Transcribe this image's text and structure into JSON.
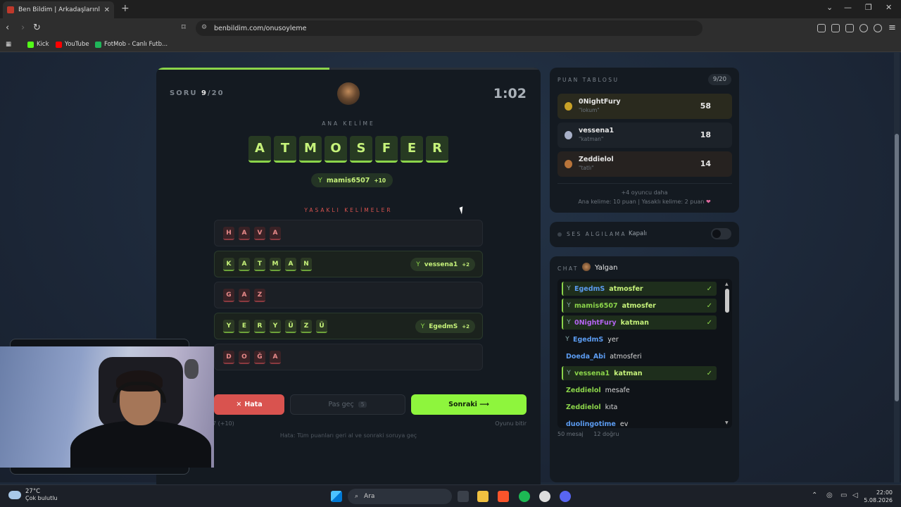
{
  "browser": {
    "tab_title": "Ben Bildim | Arkadaşlarınla Onlin",
    "url": "benbildim.com/onusoyleme",
    "bookmarks": [
      "Kick",
      "YouTube",
      "FotMob - Canlı Futb..."
    ]
  },
  "game": {
    "soru_label": "SORU",
    "soru_current": "9",
    "soru_total": "/20",
    "progress_fraction": 0.45,
    "timer": "1:02",
    "main_word_label": "ANA KELİME",
    "main_word_letters": [
      "A",
      "T",
      "M",
      "O",
      "S",
      "F",
      "E",
      "R"
    ],
    "main_guess": {
      "user": "mamis6507",
      "points": "+10"
    },
    "forbidden_label": "YASAKLI KELİMELER",
    "forbidden": [
      {
        "letters": [
          "H",
          "A",
          "V",
          "A"
        ],
        "hit": false,
        "user": "",
        "points": ""
      },
      {
        "letters": [
          "K",
          "A",
          "T",
          "M",
          "A",
          "N"
        ],
        "hit": true,
        "user": "vessena1",
        "points": "+2"
      },
      {
        "letters": [
          "G",
          "A",
          "Z"
        ],
        "hit": false,
        "user": "",
        "points": ""
      },
      {
        "letters": [
          "Y",
          "E",
          "R",
          "Y",
          "Ü",
          "Z",
          "Ü"
        ],
        "hit": true,
        "user": "EgedmS",
        "points": "+2"
      },
      {
        "letters": [
          "D",
          "O",
          "Ğ",
          "A"
        ],
        "hit": false,
        "user": "",
        "points": ""
      }
    ],
    "btn_hata": "Hata",
    "btn_pas": "Pas geç",
    "btn_pas_count": "5",
    "btn_sonraki": "Sonraki ⟶",
    "sub_left": "7 (+10)",
    "sub_right": "Oyunu bitir",
    "hint": "Hata: Tüm puanları geri al ve sonraki soruya geç"
  },
  "scoreboard": {
    "title": "PUAN TABLOSU",
    "badge": "9/20",
    "rows": [
      {
        "name": "0NightFury",
        "word": "\"lokum\"",
        "score": "58"
      },
      {
        "name": "vessena1",
        "word": "\"katman\"",
        "score": "18"
      },
      {
        "name": "Zeddielol",
        "word": "\"tatlı\"",
        "score": "14"
      }
    ],
    "more": "+4 oyuncu daha",
    "rules": "Ana kelime: 10 puan | Yasaklı kelime: 2 puan"
  },
  "voice": {
    "label": "SES ALGILAMA",
    "state": "Kapalı"
  },
  "chat": {
    "label": "CHAT",
    "user": "Yalgan",
    "messages": [
      {
        "user": "EgedmS",
        "text": "atmosfer",
        "ok": true,
        "color": "#5b9bf0"
      },
      {
        "user": "mamis6507",
        "text": "atmosfer",
        "ok": true,
        "color": "#8bd44a"
      },
      {
        "user": "0NightFury",
        "text": "katman",
        "ok": true,
        "color": "#b464f0"
      },
      {
        "user": "EgedmS",
        "text": "yer",
        "ok": false,
        "color": "#5b9bf0"
      },
      {
        "user": "Doeda_Abi",
        "text": "atmosferi",
        "ok": false,
        "color": "#5b9bf0"
      },
      {
        "user": "vessena1",
        "text": "katman",
        "ok": true,
        "color": "#8bd44a"
      },
      {
        "user": "Zeddielol",
        "text": "mesafe",
        "ok": false,
        "color": "#8bd44a"
      },
      {
        "user": "Zeddielol",
        "text": "kıta",
        "ok": false,
        "color": "#8bd44a"
      },
      {
        "user": "duolingotime",
        "text": "ev",
        "ok": false,
        "color": "#5b9bf0"
      }
    ],
    "footer_count": "50 mesaj",
    "footer_correct": "12 doğru"
  },
  "taskbar": {
    "temp": "27°C",
    "weather": "Çok bulutlu",
    "search": "Ara",
    "time": "22:00",
    "date": "5.08.2026"
  }
}
